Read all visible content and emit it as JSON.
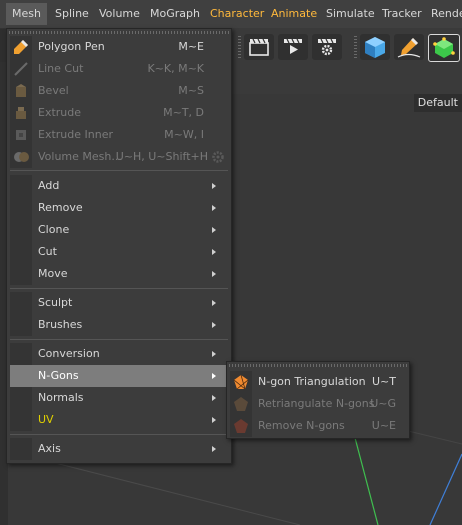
{
  "menubar": {
    "items": [
      "Mesh",
      "Spline",
      "Volume",
      "MoGraph",
      "Character",
      "Animate",
      "Simulate",
      "Tracker",
      "Rende"
    ]
  },
  "viewport": {
    "tab_label": "Default"
  },
  "mesh_menu": {
    "top_items": [
      {
        "label": "Polygon Pen",
        "shortcut": "M~E",
        "enabled": true,
        "icon": "polygon-pen-icon"
      },
      {
        "label": "Line Cut",
        "shortcut": "K~K, M~K",
        "enabled": false,
        "icon": "line-cut-icon"
      },
      {
        "label": "Bevel",
        "shortcut": "M~S",
        "enabled": false,
        "icon": "bevel-icon"
      },
      {
        "label": "Extrude",
        "shortcut": "M~T, D",
        "enabled": false,
        "icon": "extrude-icon"
      },
      {
        "label": "Extrude Inner",
        "shortcut": "M~W, I",
        "enabled": false,
        "icon": "extrude-inner-icon"
      },
      {
        "label": "Volume Mesh...",
        "shortcut": "U~H, U~Shift+H",
        "enabled": false,
        "icon": "volume-mesh-icon"
      }
    ],
    "group_a": [
      "Add",
      "Remove",
      "Clone",
      "Cut",
      "Move"
    ],
    "group_b": [
      "Sculpt",
      "Brushes"
    ],
    "group_c": [
      "Conversion",
      "N-Gons",
      "Normals",
      "UV"
    ],
    "group_d": [
      "Axis"
    ]
  },
  "ngons_submenu": [
    {
      "label": "N-gon Triangulation",
      "shortcut": "U~T",
      "enabled": true,
      "icon": "ngon-triangulation-icon"
    },
    {
      "label": "Retriangulate N-gons",
      "shortcut": "U~G",
      "enabled": false,
      "icon": "retriangulate-icon"
    },
    {
      "label": "Remove N-gons",
      "shortcut": "U~E",
      "enabled": false,
      "icon": "remove-ngons-icon"
    }
  ],
  "colors": {
    "accent_orange": "#ffb93c",
    "highlight": "#7d7d7d",
    "menu_bg": "#3c3c3c"
  }
}
